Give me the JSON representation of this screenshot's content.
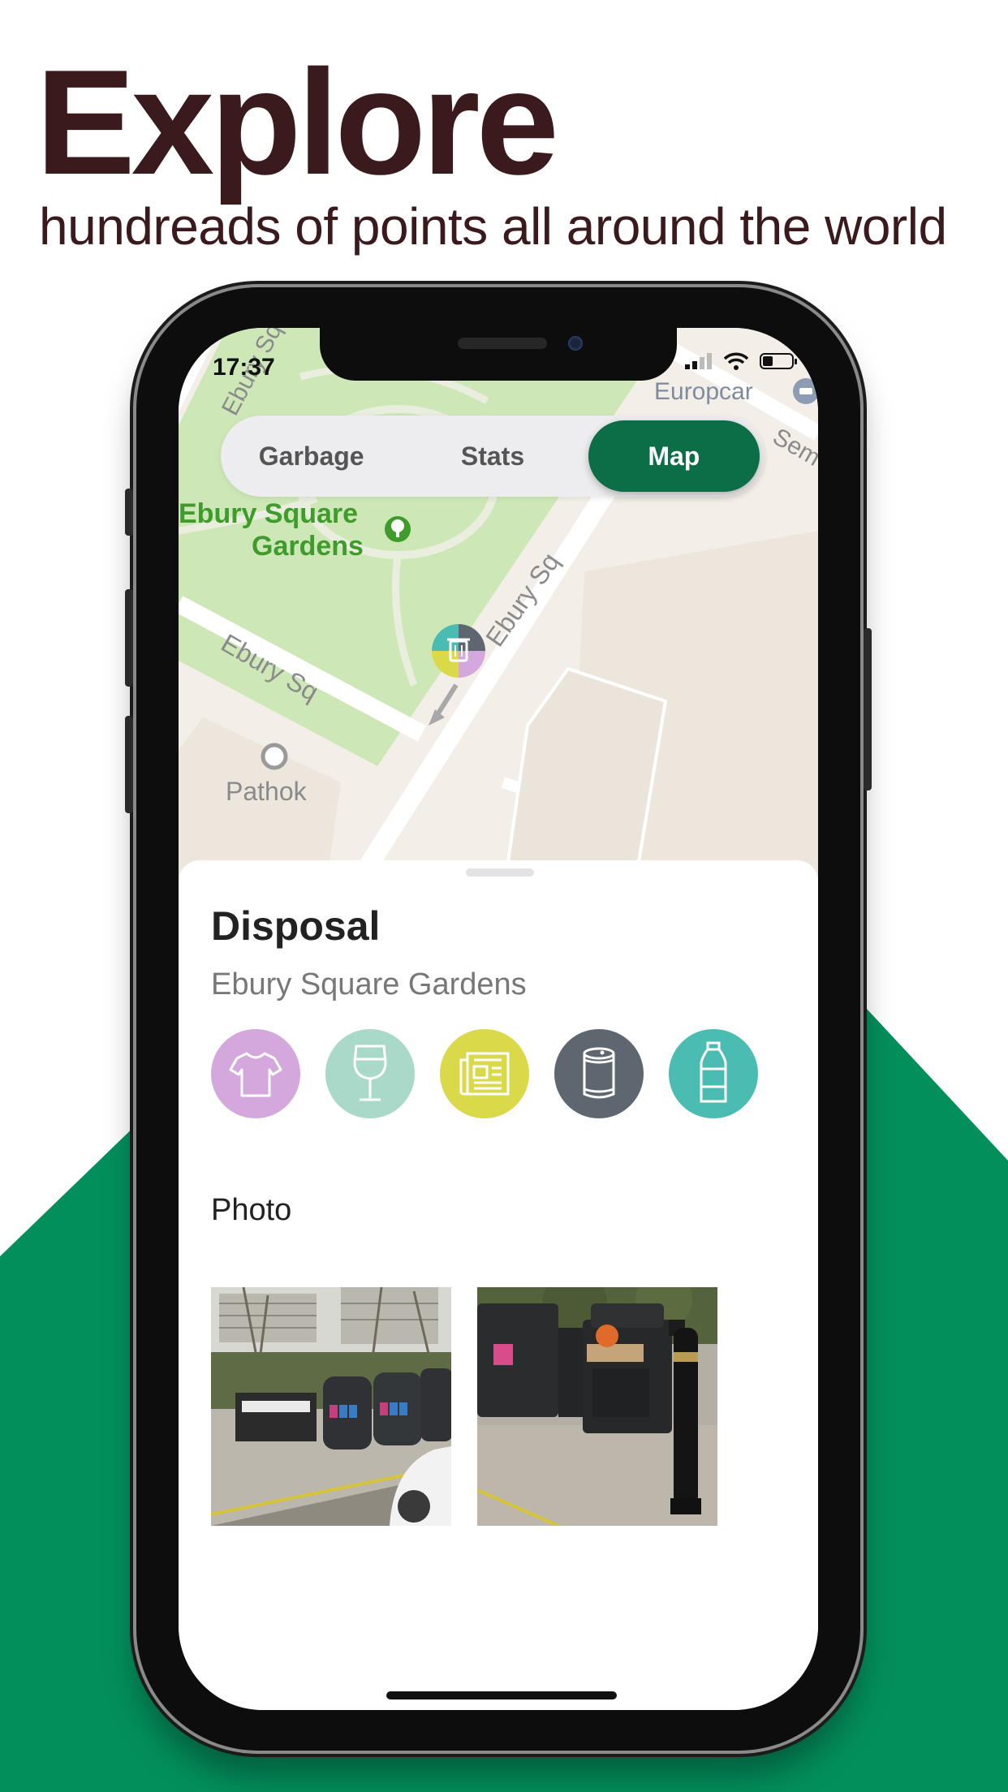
{
  "hero": {
    "title": "Explore",
    "subtitle": "hundreads of points all around the world"
  },
  "status_bar": {
    "time": "17:37"
  },
  "map": {
    "labels": {
      "park": [
        "Ebury Square",
        "Gardens"
      ],
      "street_top": "Ebury Sq",
      "street_diag": "Ebury Sq",
      "street_left": "Ebury Sq",
      "poi": "Pathok",
      "europcar": "Europcar",
      "street_right": "Sem"
    },
    "marker_icon": "trash-icon"
  },
  "tabs": [
    {
      "label": "Garbage",
      "active": false
    },
    {
      "label": "Stats",
      "active": false
    },
    {
      "label": "Map",
      "active": true
    }
  ],
  "detail": {
    "title": "Disposal",
    "location": "Ebury Square Gardens",
    "categories": [
      {
        "icon": "tshirt-icon",
        "color": "#d4a8dd"
      },
      {
        "icon": "wine-glass-icon",
        "color": "#a9dac9"
      },
      {
        "icon": "newspaper-icon",
        "color": "#d9d94a"
      },
      {
        "icon": "can-icon",
        "color": "#5e6770"
      },
      {
        "icon": "bottle-icon",
        "color": "#4bbcb2"
      }
    ],
    "photo_label": "Photo"
  },
  "colors": {
    "brand_green": "#038f5c",
    "headline": "#3a1a1d",
    "tab_active": "#0b6e46"
  }
}
